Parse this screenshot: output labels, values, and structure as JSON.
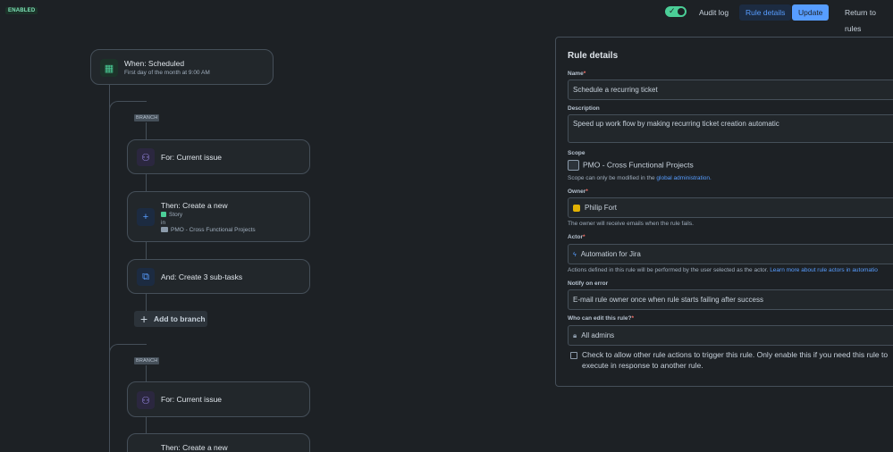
{
  "status_badge": "ENABLED",
  "header": {
    "audit_log": "Audit log",
    "rule_details": "Rule details",
    "update": "Update",
    "return_to_rules": "Return to rules"
  },
  "flow": {
    "trigger": {
      "title": "When: Scheduled",
      "subtitle": "First day of the month at 9:00 AM"
    },
    "branch_label": "BRANCH",
    "branch1": {
      "for_title": "For: Current issue",
      "create_title": "Then: Create a new",
      "issue_type": "Story",
      "in_label": "in",
      "project": "PMO - Cross Functional Projects",
      "subtasks_title": "And: Create 3 sub-tasks",
      "add_to_branch": "Add to branch"
    },
    "branch2": {
      "for_title": "For: Current issue",
      "create_title": "Then: Create a new"
    }
  },
  "panel": {
    "title": "Rule details",
    "name_label": "Name",
    "name_value": "Schedule a recurring ticket",
    "description_label": "Description",
    "description_value": "Speed up work flow by making recurring ticket creation automatic",
    "scope_label": "Scope",
    "scope_value": "PMO - Cross Functional Projects",
    "scope_help_prefix": "Scope can only be modified in the",
    "scope_help_link": "global administration.",
    "owner_label": "Owner",
    "owner_value": "Philip Fort",
    "owner_help": "The owner will receive emails when the rule fails.",
    "actor_label": "Actor",
    "actor_value": "Automation for Jira",
    "actor_help_prefix": "Actions defined in this rule will be performed by the user selected as the actor.",
    "actor_help_link": "Learn more about rule actors in automatio",
    "notify_label": "Notify on error",
    "notify_value": "E-mail rule owner once when rule starts failing after success",
    "edit_label": "Who can edit this rule?",
    "edit_value": "All admins",
    "checkbox_text": "Check to allow other rule actions to trigger this rule. Only enable this if you need this rule to execute in response to another rule."
  },
  "colors": {
    "accent": "#579dff",
    "success": "#4bce97",
    "background": "#1d2125"
  }
}
